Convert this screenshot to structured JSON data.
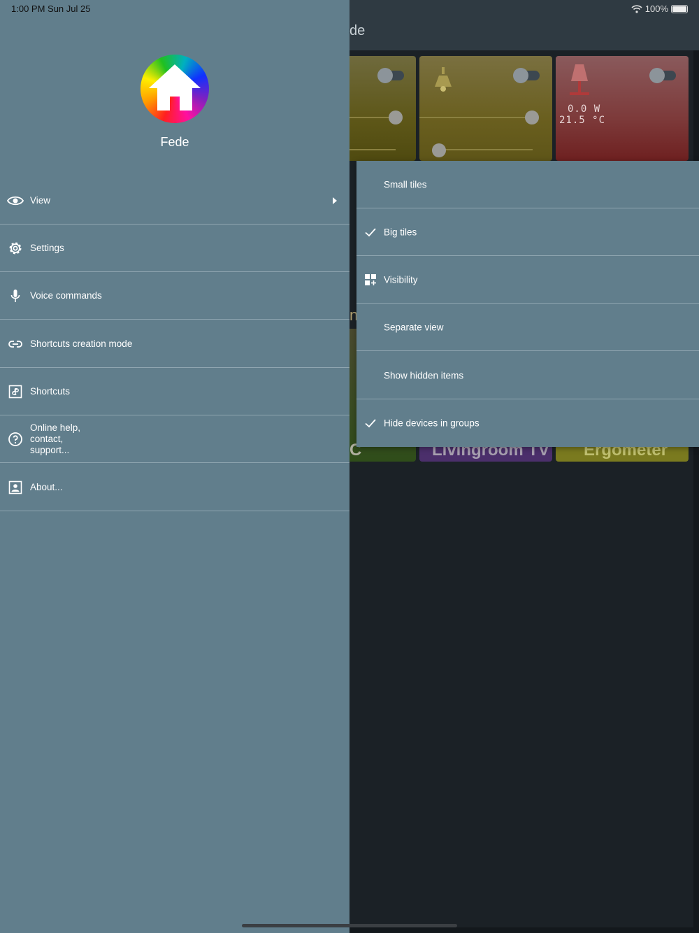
{
  "status_bar": {
    "time": "1:00 PM   Sun Jul 25",
    "battery": "100%"
  },
  "background": {
    "title_fragment": "de",
    "tile_power": "0.0 W",
    "tile_temperature": "21.5 °C",
    "tile_label_c": "C",
    "tile_label_n": "n",
    "tile_livingroom": "Livingroom TV",
    "tile_ergometer": "Ergometer"
  },
  "drawer": {
    "user_name": "Fede",
    "items": [
      {
        "label": "View",
        "icon": "eye-icon",
        "has_submenu": true
      },
      {
        "label": "Settings",
        "icon": "gear-icon"
      },
      {
        "label": "Voice commands",
        "icon": "microphone-icon"
      },
      {
        "label": "Shortcuts creation mode",
        "icon": "link-icon"
      },
      {
        "label": "Shortcuts",
        "icon": "shortcut-icon"
      },
      {
        "label": "Online help,\ncontact,\nsupport...",
        "icon": "help-icon"
      },
      {
        "label": "About...",
        "icon": "contact-card-icon"
      }
    ]
  },
  "view_submenu": {
    "items": [
      {
        "label": "Small tiles",
        "checked": false
      },
      {
        "label": "Big tiles",
        "checked": true
      },
      {
        "label": "Visibility",
        "icon": "visibility-grid-icon"
      },
      {
        "label": "Separate view",
        "checked": false
      },
      {
        "label": "Show hidden items",
        "checked": false
      },
      {
        "label": "Hide devices in groups",
        "checked": true
      }
    ]
  },
  "colors": {
    "drawer": "#617e8c",
    "divider": "#8fa5b0",
    "background": "#13181c"
  }
}
